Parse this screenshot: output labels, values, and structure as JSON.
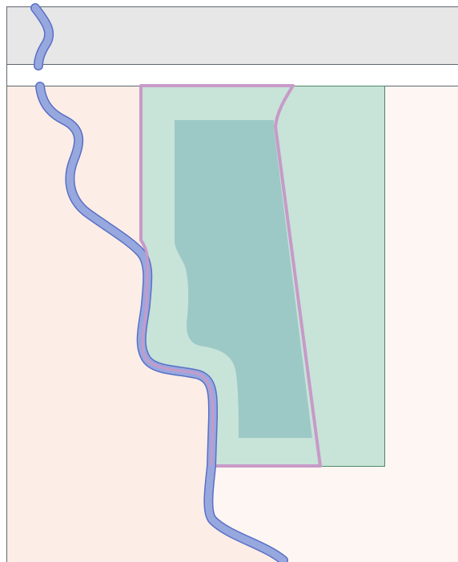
{
  "colors": {
    "page_background": "#ffffff",
    "top_band_fill": "#e7e7e7",
    "top_band_border": "#5e6670",
    "light_band_fill": "#ffffff",
    "left_zone_fill": "#fcede6",
    "right_zone_fill": "#fdf6f2",
    "outer_region_fill": "#c8e3d8",
    "outer_region_border": "#4e8a66",
    "inner_region_fill": "#9cc9c6",
    "outline_stroke": "#c79ac8",
    "river_edge": "#5a6fc5",
    "river_core": "#97a8df"
  },
  "icons": {
    "river": "meandering-river-line",
    "outline": "boundary-outline-polygon"
  }
}
